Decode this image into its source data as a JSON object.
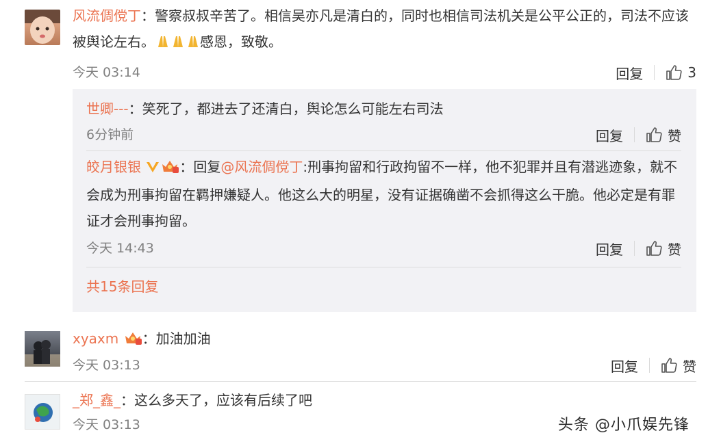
{
  "comments": [
    {
      "username": "风流倜傥丁",
      "text_part1": "：警察叔叔辛苦了。相信吴亦凡是清白的，同时也相信司法机关是公平公正的，司法不应该被舆论左右。",
      "text_part2": "感恩，致敬。",
      "time": "今天 03:14",
      "reply_label": "回复",
      "like_count": "3"
    },
    {
      "username": "xyaxm",
      "text": "：加油加油",
      "time": "今天 03:13",
      "reply_label": "回复",
      "like_label": "赞"
    },
    {
      "username": "_郑_鑫_",
      "text": "：这么多天了，应该有后续了吧",
      "time": "今天 03:13"
    }
  ],
  "replies": [
    {
      "username": "世卿---",
      "text": "：笑死了，都进去了还清白，舆论怎么可能左右司法",
      "time": "6分钟前",
      "reply_label": "回复",
      "like_label": "赞"
    },
    {
      "username": "皎月银银",
      "reply_prefix": "：回复",
      "mention": "@风流倜傥丁",
      "text": ":刑事拘留和行政拘留不一样，他不犯罪并且有潜逃迹象，就不会成为刑事拘留在羁押嫌疑人。他这么大的明星，没有证据确凿不会抓得这么干脆。他必定是有罪证才会刑事拘留。",
      "time": "今天 14:43",
      "reply_label": "回复",
      "like_label": "赞"
    }
  ],
  "more_replies": "共15条回复",
  "watermark": "头条 @小爪娱先锋",
  "colors": {
    "username": "#eb7350",
    "reply_bg": "#f2f2f5",
    "muted": "#808080"
  }
}
